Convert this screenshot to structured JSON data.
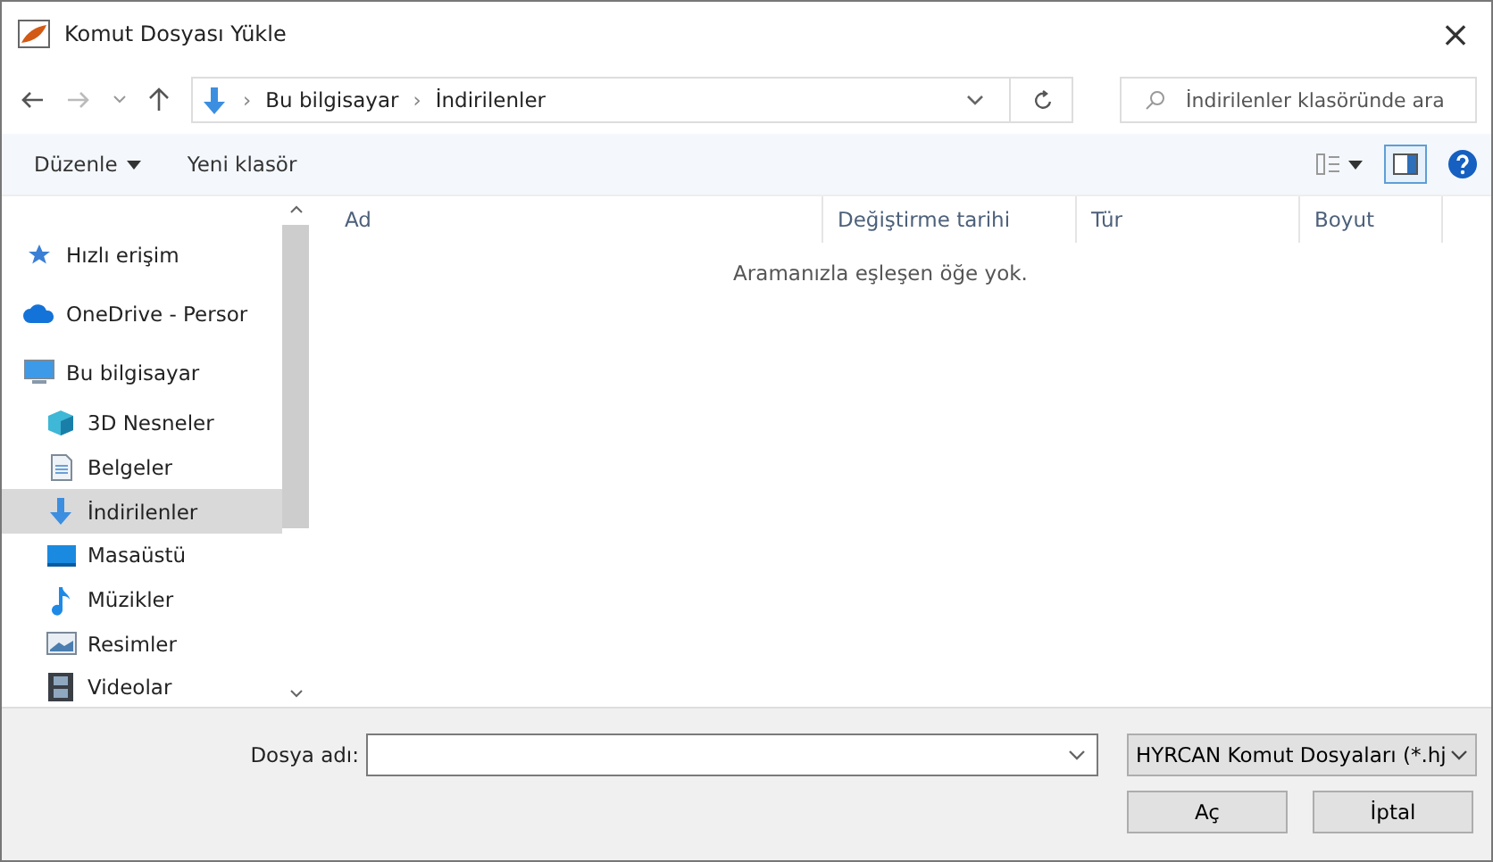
{
  "window": {
    "title": "Komut Dosyası Yükle",
    "close": "×"
  },
  "address": {
    "path": [
      {
        "label": "Bu bilgisayar"
      },
      {
        "label": "İndirilenler"
      }
    ],
    "separator": "›"
  },
  "search": {
    "placeholder": "İndirilenler klasöründe ara"
  },
  "toolbar": {
    "organize": "Düzenle",
    "new_folder": "Yeni klasör",
    "preview_pane_on": true
  },
  "sidebar": {
    "items": [
      {
        "label": "Hızlı erişim",
        "kind": "star",
        "selected": false
      },
      {
        "label": "OneDrive - Persor",
        "kind": "cloud",
        "selected": false
      },
      {
        "label": "Bu bilgisayar",
        "kind": "pc",
        "selected": false,
        "children": [
          {
            "label": "3D Nesneler",
            "kind": "cube",
            "selected": false
          },
          {
            "label": "Belgeler",
            "kind": "doc",
            "selected": false
          },
          {
            "label": "İndirilenler",
            "kind": "download",
            "selected": true
          },
          {
            "label": "Masaüstü",
            "kind": "desktop",
            "selected": false
          },
          {
            "label": "Müzikler",
            "kind": "music",
            "selected": false
          },
          {
            "label": "Resimler",
            "kind": "image",
            "selected": false
          },
          {
            "label": "Videolar",
            "kind": "video",
            "selected": false
          }
        ]
      }
    ]
  },
  "table": {
    "columns": [
      "Ad",
      "Değiştirme tarihi",
      "Tür",
      "Boyut"
    ],
    "empty_message": "Aramanızla eşleşen öğe yok."
  },
  "footer": {
    "filename_label": "Dosya adı:",
    "filter": "HYRCAN Komut Dosyaları (*.hj",
    "buttons": [
      "Aç",
      "İptal"
    ]
  }
}
